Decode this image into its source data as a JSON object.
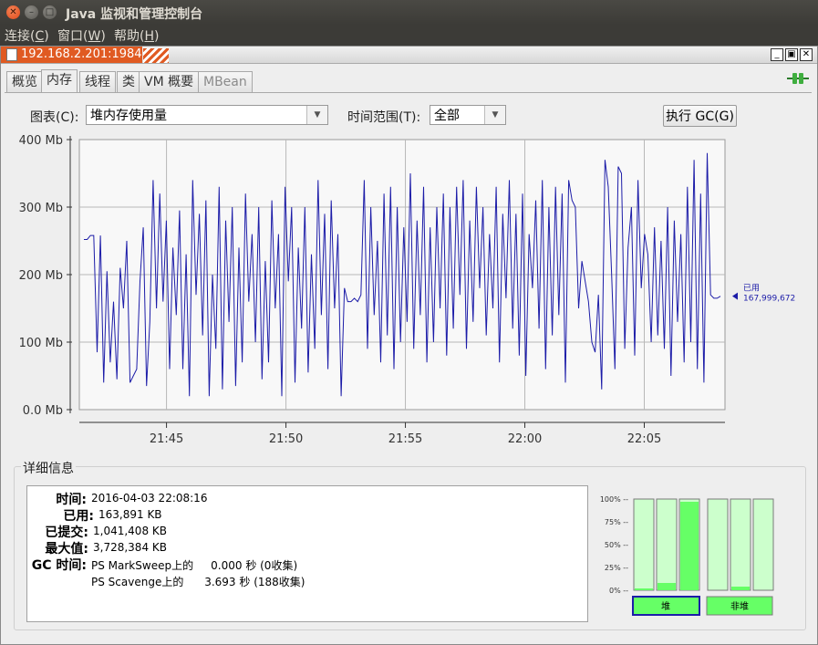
{
  "window": {
    "title": "Java 监视和管理控制台"
  },
  "menu": [
    {
      "label": "连接(",
      "key": "C",
      "end": ")"
    },
    {
      "label": "窗口(",
      "key": "W",
      "end": ")"
    },
    {
      "label": "帮助(",
      "key": "H",
      "end": ")"
    }
  ],
  "frame": {
    "title": "192.168.2.201:1984"
  },
  "tabs": [
    "概览",
    "内存",
    "线程",
    "类",
    "VM 概要",
    "MBean"
  ],
  "controls": {
    "chart_label": "图表(C):",
    "chart_value": "堆内存使用量",
    "range_label": "时间范围(T):",
    "range_value": "全部",
    "gc_button": "执行 GC(G)"
  },
  "chart_data": {
    "type": "line",
    "title": "",
    "xlabel": "",
    "ylabel": "",
    "ylim": [
      0,
      400
    ],
    "y_ticks": [
      "0.0 Mb",
      "100 Mb",
      "200 Mb",
      "300 Mb",
      "400 Mb"
    ],
    "x_ticks": [
      "21:45",
      "21:50",
      "21:55",
      "22:00",
      "22:05"
    ],
    "grid": true,
    "color": "#1c1ca8",
    "legend": {
      "label": "已用",
      "value": "167,999,672"
    },
    "series": [
      {
        "name": "已用",
        "values": [
          252,
          252,
          258,
          258,
          85,
          258,
          40,
          205,
          70,
          160,
          45,
          210,
          150,
          250,
          40,
          50,
          60,
          190,
          270,
          35,
          130,
          340,
          150,
          320,
          160,
          280,
          60,
          240,
          140,
          295,
          60,
          230,
          20,
          340,
          170,
          290,
          110,
          310,
          20,
          200,
          90,
          330,
          30,
          280,
          130,
          300,
          35,
          240,
          70,
          320,
          160,
          260,
          100,
          300,
          45,
          220,
          70,
          310,
          150,
          260,
          20,
          330,
          190,
          300,
          40,
          240,
          120,
          300,
          55,
          230,
          90,
          340,
          140,
          290,
          60,
          310,
          150,
          260,
          20,
          180,
          160,
          160,
          165,
          160,
          170,
          340,
          90,
          300,
          140,
          250,
          70,
          320,
          110,
          330,
          60,
          300,
          100,
          270,
          130,
          350,
          90,
          280,
          140,
          330,
          70,
          270,
          100,
          300,
          150,
          320,
          80,
          300,
          120,
          330,
          170,
          340,
          90,
          280,
          130,
          330,
          180,
          300,
          110,
          260,
          150,
          330,
          70,
          290,
          165,
          340,
          120,
          290,
          80,
          320,
          50,
          260,
          180,
          310,
          120,
          340,
          60,
          300,
          110,
          330,
          140,
          320,
          40,
          340,
          310,
          300,
          150,
          220,
          190,
          160,
          100,
          85,
          170,
          30,
          370,
          330,
          200,
          60,
          360,
          350,
          90,
          240,
          300,
          80,
          340,
          180,
          260,
          230,
          100,
          270,
          110,
          250,
          90,
          300,
          50,
          280,
          130,
          260,
          70,
          330,
          100,
          370,
          60,
          320,
          40,
          380,
          170,
          165,
          165,
          168
        ]
      }
    ]
  },
  "details": {
    "title": "详细信息",
    "rows": [
      {
        "key": "时间:",
        "value": "2016-04-03 22:08:16"
      },
      {
        "key": "已用:",
        "value": "163,891 KB"
      },
      {
        "key": "已提交:",
        "value": "1,041,408 KB"
      },
      {
        "key": "最大值:",
        "value": "3,728,384 KB"
      },
      {
        "key": "GC 时间:",
        "value": "PS MarkSweep上的     0.000 秒 (0收集)"
      },
      {
        "key": "",
        "value": "PS Scavenge上的      3.693 秒 (188收集)"
      }
    ]
  },
  "mem_panel": {
    "y_labels": [
      "100%",
      "75%",
      "50%",
      "25%",
      "0%"
    ],
    "heap_bars": [
      0.02,
      0.08,
      0.97
    ],
    "nonheap_bars": [
      0.0,
      0.04,
      0.0
    ],
    "heap_label": "堆",
    "nonheap_label": "非堆"
  }
}
